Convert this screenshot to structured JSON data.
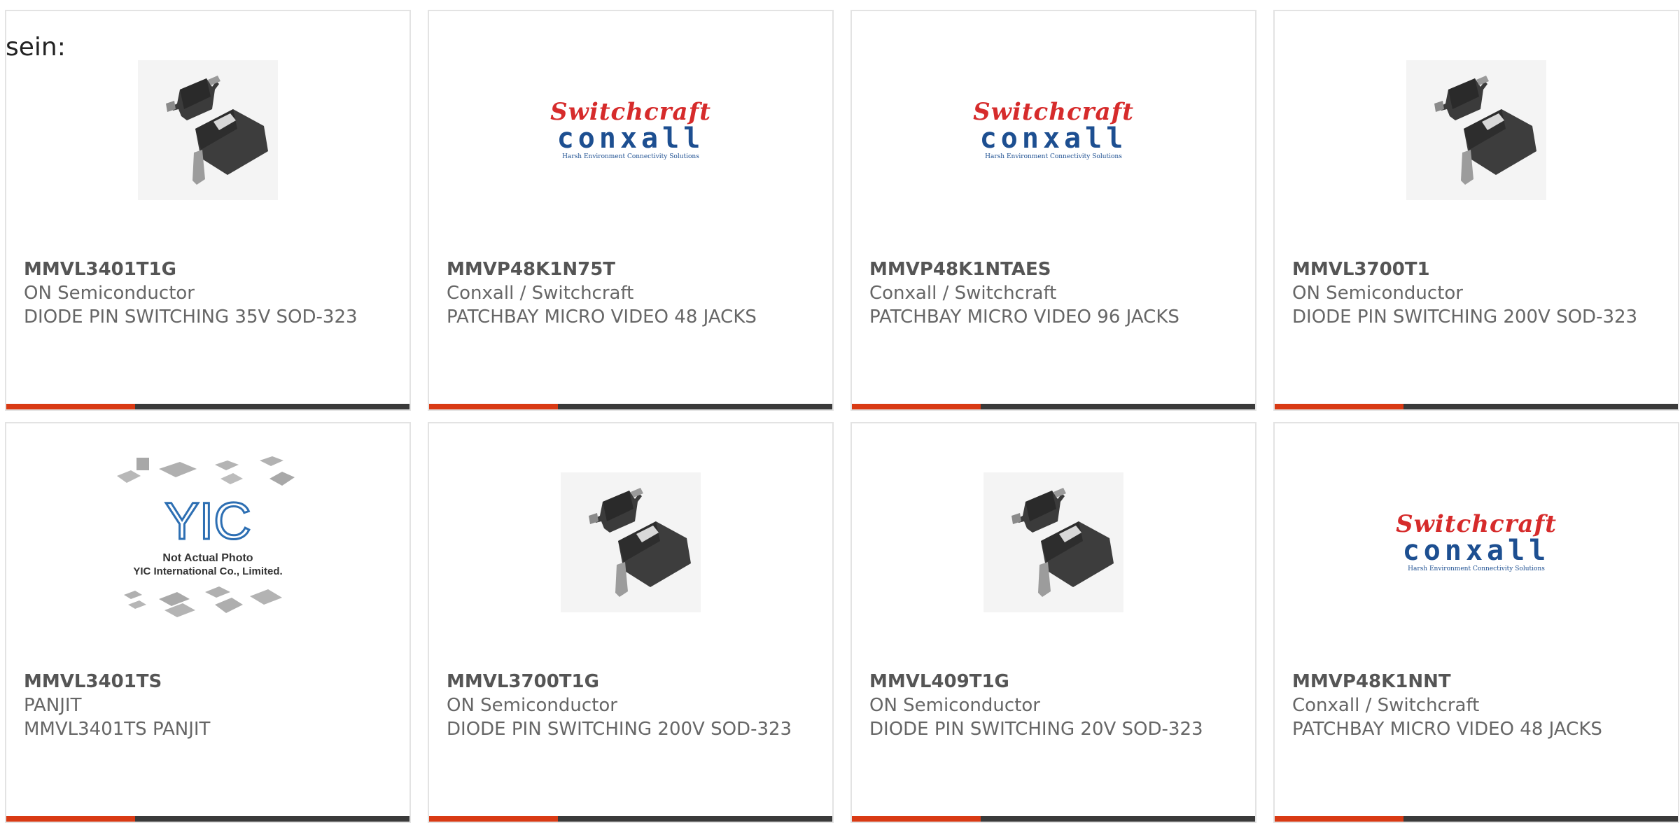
{
  "intro_text": "sein:",
  "cards": [
    {
      "part_number": "MMVL3401T1G",
      "manufacturer": "ON Semiconductor",
      "description": "DIODE PIN SWITCHING 35V SOD-323",
      "image": "diode-sod323-icon"
    },
    {
      "part_number": "MMVP48K1N75T",
      "manufacturer": "Conxall / Switchcraft",
      "description": "PATCHBAY MICRO VIDEO 48 JACKS",
      "image": "switchcraft-conxall-logo"
    },
    {
      "part_number": "MMVP48K1NTAES",
      "manufacturer": "Conxall / Switchcraft",
      "description": "PATCHBAY MICRO VIDEO 96 JACKS",
      "image": "switchcraft-conxall-logo"
    },
    {
      "part_number": "MMVL3700T1",
      "manufacturer": "ON Semiconductor",
      "description": "DIODE PIN SWITCHING 200V SOD-323",
      "image": "diode-sod323-icon"
    },
    {
      "part_number": "MMVL3401TS",
      "manufacturer": "PANJIT",
      "description": "MMVL3401TS PANJIT",
      "image": "yic-not-actual-photo"
    },
    {
      "part_number": "MMVL3700T1G",
      "manufacturer": "ON Semiconductor",
      "description": "DIODE PIN SWITCHING 200V SOD-323",
      "image": "diode-sod323-icon"
    },
    {
      "part_number": "MMVL409T1G",
      "manufacturer": "ON Semiconductor",
      "description": "DIODE PIN SWITCHING 20V SOD-323",
      "image": "diode-sod323-icon"
    },
    {
      "part_number": "MMVP48K1NNT",
      "manufacturer": "Conxall / Switchcraft",
      "description": "PATCHBAY MICRO VIDEO 48 JACKS",
      "image": "switchcraft-conxall-logo"
    }
  ],
  "logos": {
    "switchcraft_word": "Switchcraft",
    "conxall_word": "conxall",
    "conxall_tagline": "Harsh Environment Connectivity Solutions",
    "yic_mark": "YIC",
    "yic_line1": "Not Actual Photo",
    "yic_line2": "YIC International Co., Limited."
  },
  "colors": {
    "accent": "#d93a14",
    "bar": "#3a3a3a",
    "border": "#e3e3e3",
    "switchcraft_red": "#d62b2b",
    "conxall_blue": "#1d4f91"
  }
}
